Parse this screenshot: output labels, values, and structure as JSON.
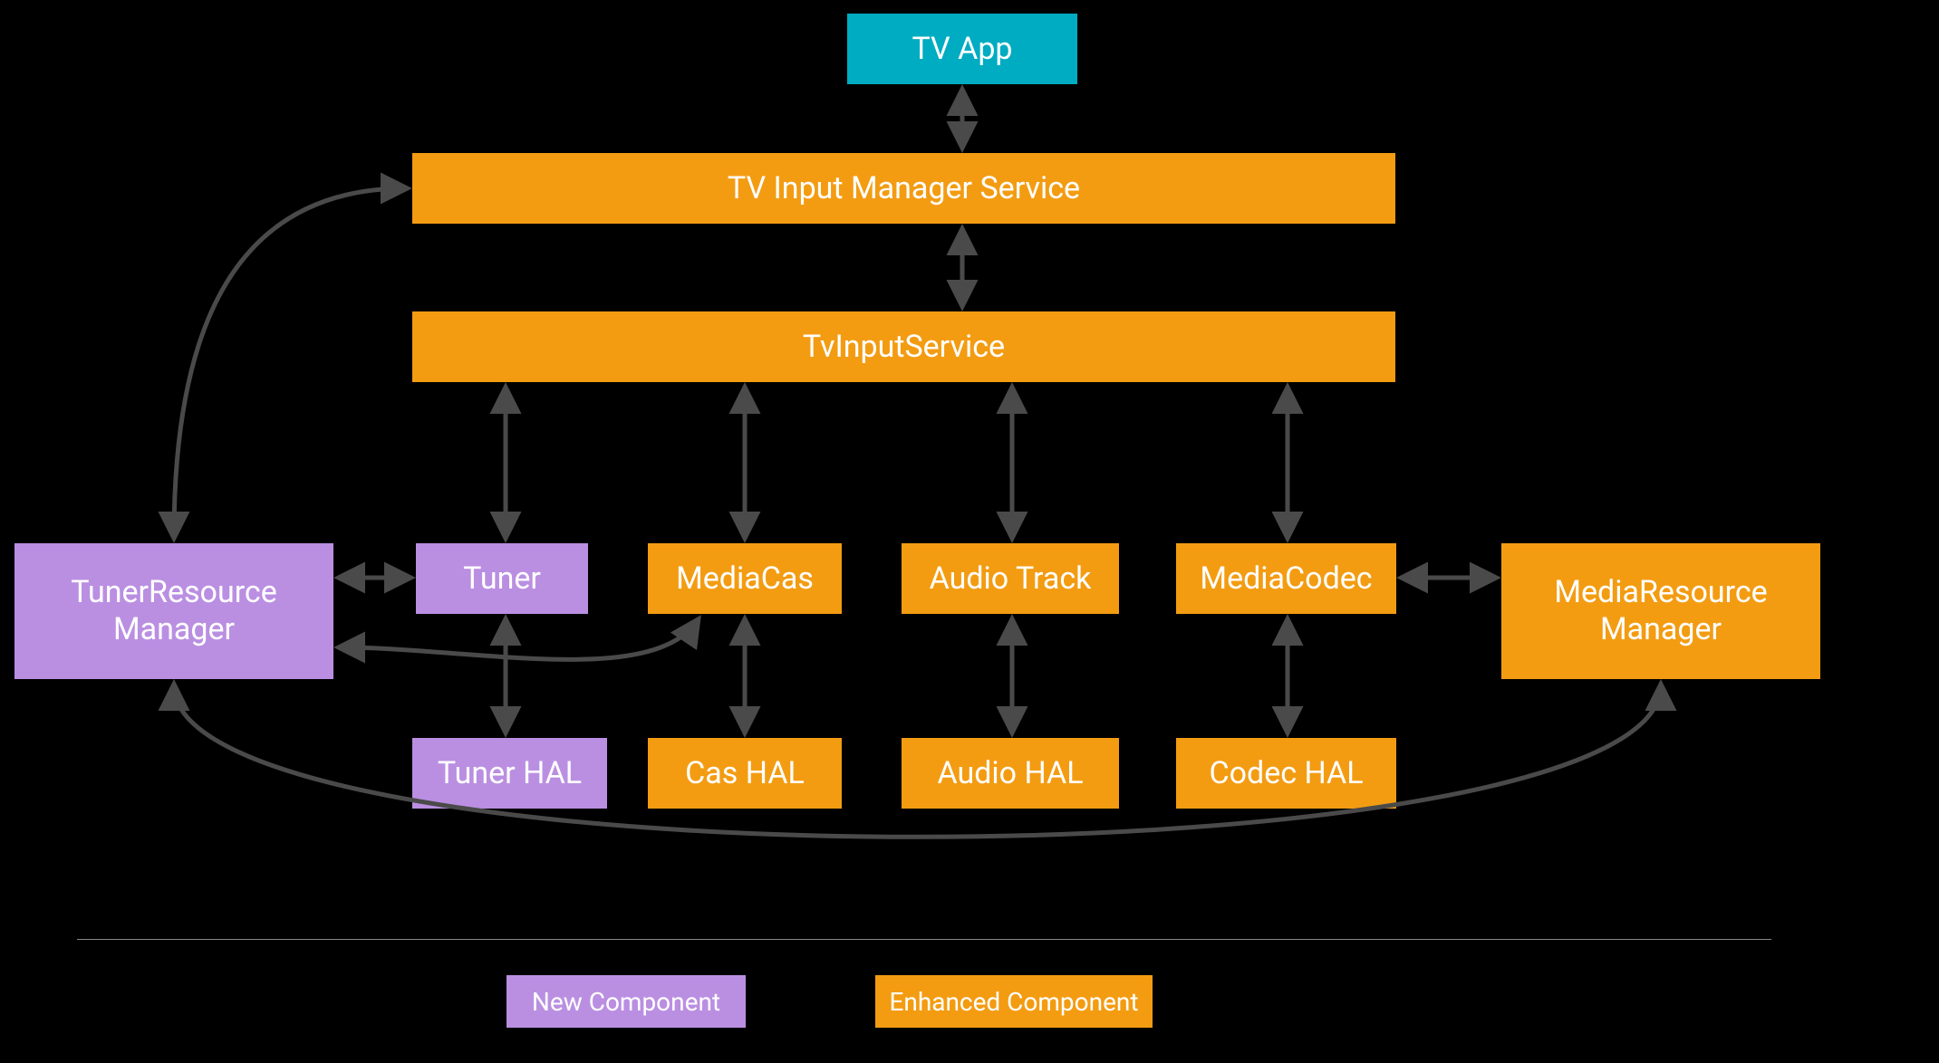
{
  "nodes": {
    "tv_app": "TV App",
    "tv_input_manager_service": "TV Input Manager Service",
    "tv_input_service": "TvInputService",
    "tuner_resource_manager_l1": "TunerResource",
    "tuner_resource_manager_l2": "Manager",
    "tuner": "Tuner",
    "media_cas": "MediaCas",
    "audio_track": "Audio Track",
    "media_codec": "MediaCodec",
    "media_resource_manager_l1": "MediaResource",
    "media_resource_manager_l2": "Manager",
    "tuner_hal": "Tuner HAL",
    "cas_hal": "Cas HAL",
    "audio_hal": "Audio HAL",
    "codec_hal": "Codec HAL"
  },
  "legend": {
    "new_component": "New Component",
    "enhanced_component": "Enhanced Component"
  },
  "colors": {
    "blue": "#00ACC1",
    "orange": "#F39C12",
    "purple": "#BA8FE2",
    "arrow": "#4A4A4A",
    "background": "#000000"
  }
}
